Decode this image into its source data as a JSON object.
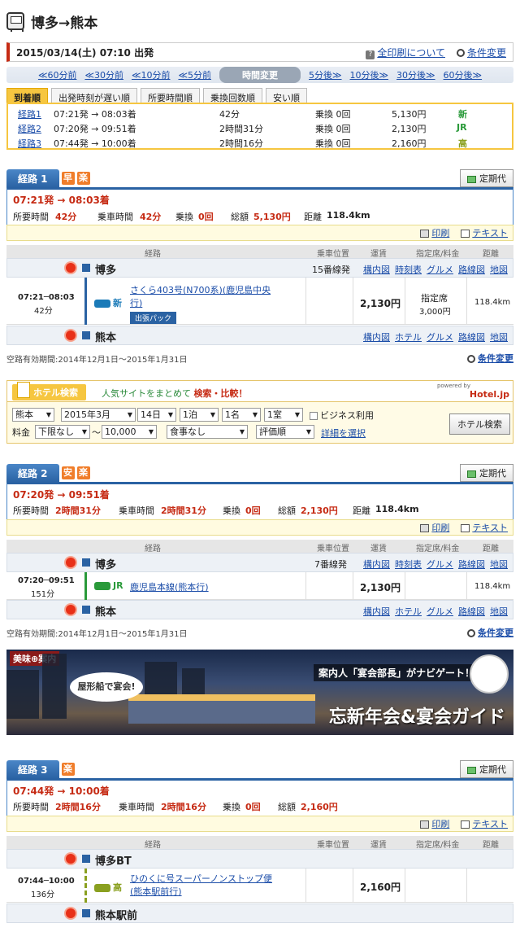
{
  "header": {
    "title": "博多→熊本"
  },
  "datebar": {
    "datetime": "2015/03/14(土) 07:10 出発",
    "print_all": "全印刷について",
    "change_cond": "条件変更"
  },
  "timeshift": {
    "back60": "≪60分前",
    "back30": "≪30分前",
    "back10": "≪10分前",
    "back5": "≪5分前",
    "label": "時間変更",
    "fwd5": "5分後≫",
    "fwd10": "10分後≫",
    "fwd30": "30分後≫",
    "fwd60": "60分後≫"
  },
  "tabs": [
    "到着順",
    "出発時刻が遅い順",
    "所要時間順",
    "乗換回数順",
    "安い順"
  ],
  "summary": [
    {
      "route": "経路1",
      "time": "07:21発 → 08:03着",
      "duration": "42分",
      "transfer": "乗換 0回",
      "fare": "5,130円",
      "mark": "新",
      "mark_color": "#2a9a3a"
    },
    {
      "route": "経路2",
      "time": "07:20発 → 09:51着",
      "duration": "2時間31分",
      "transfer": "乗換 0回",
      "fare": "2,130円",
      "mark": "JR",
      "mark_color": "#2a9a3a"
    },
    {
      "route": "経路3",
      "time": "07:44発 → 10:00着",
      "duration": "2時間16分",
      "transfer": "乗換 0回",
      "fare": "2,160円",
      "mark": "高",
      "mark_color": "#8aa020"
    }
  ],
  "common": {
    "teiki": "定期代",
    "print": "印刷",
    "text": "テキスト",
    "col_route": "経路",
    "col_pos": "乗車位置",
    "col_fare": "運賃",
    "col_seat": "指定席/料金",
    "col_dist": "距離",
    "validity": "空路有効期間:2014年12月1日〜2015年1月31日",
    "cond_change": "条件変更",
    "link_map_in": "構内図",
    "link_timetable": "時刻表",
    "link_gourmet": "グルメ",
    "link_route": "路線図",
    "link_map": "地図",
    "link_hotel": "ホテル"
  },
  "routes": [
    {
      "label": "経路 1",
      "badges": [
        "早",
        "楽"
      ],
      "time": "07:21発 → 08:03着",
      "req_label": "所要時間",
      "req": "42分",
      "ride_label": "乗車時間",
      "ride": "42分",
      "tr_label": "乗換",
      "tr": "0回",
      "fare_label": "総額",
      "fare": "5,130円",
      "dist_label": "距離",
      "dist": "118.4km",
      "from": "博多",
      "platform": "15番線発",
      "dep_arr": "07:21─08:03",
      "segdur": "42分",
      "mode": "新",
      "train": "さくら403号(N700系)(鹿児島中央行)",
      "tag": "出張パック",
      "segfare": "2,130円",
      "seat": "指定席",
      "seatfare": "3,000円",
      "segdist": "118.4km",
      "to": "熊本"
    },
    {
      "label": "経路 2",
      "badges": [
        "安",
        "楽"
      ],
      "time": "07:20発 → 09:51着",
      "req_label": "所要時間",
      "req": "2時間31分",
      "ride_label": "乗車時間",
      "ride": "2時間31分",
      "tr_label": "乗換",
      "tr": "0回",
      "fare_label": "総額",
      "fare": "2,130円",
      "dist_label": "距離",
      "dist": "118.4km",
      "from": "博多",
      "platform": "7番線発",
      "dep_arr": "07:20─09:51",
      "segdur": "151分",
      "mode": "JR",
      "train": "鹿児島本線(熊本行)",
      "segfare": "2,130円",
      "segdist": "118.4km",
      "to": "熊本"
    },
    {
      "label": "経路 3",
      "badges": [
        "楽"
      ],
      "time": "07:44発 → 10:00着",
      "req_label": "所要時間",
      "req": "2時間16分",
      "ride_label": "乗車時間",
      "ride": "2時間16分",
      "tr_label": "乗換",
      "tr": "0回",
      "fare_label": "総額",
      "fare": "2,160円",
      "from": "博多BT",
      "dep_arr": "07:44─10:00",
      "segdur": "136分",
      "mode": "高",
      "train": "ひのくに号スーパーノンストップ便(熊本駅前行)",
      "segfare": "2,160円",
      "to": "熊本駅前"
    }
  ],
  "hotel": {
    "btn": "ホテル検索",
    "tagline": "人気サイトをまとめて",
    "tagline_bold": "検索・比較！",
    "powered": "powered by",
    "brand": "Hotel.jp",
    "city": "熊本",
    "month": "2015年3月",
    "day": "14日",
    "nights": "1泊",
    "people": "1名",
    "rooms": "1室",
    "business": "ビジネス利用",
    "fare_label": "料金",
    "min": "下限なし",
    "tilde": "〜",
    "max": "10,000",
    "meal": "食事なし",
    "sort": "評価順",
    "detail": "詳細を選択",
    "search": "ホテル検索"
  },
  "banner": {
    "tag": "美味⊕案内",
    "bubble": "屋形船で宴会!",
    "guide": "案内人「宴会部長」がナビゲート！",
    "title": "忘新年会&宴会ガイド"
  }
}
